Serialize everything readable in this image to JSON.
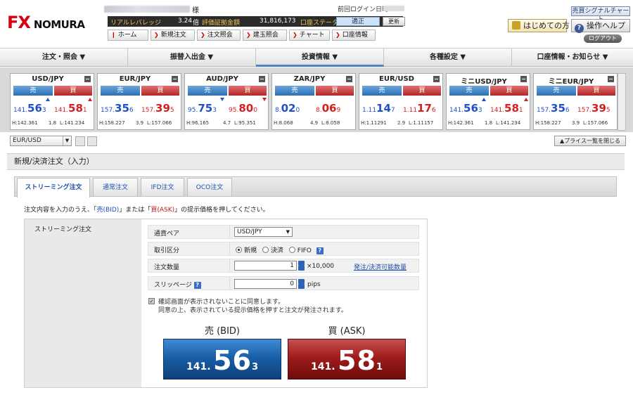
{
  "header": {
    "logo_fx": "FX",
    "logo_nomura": "NOMURA",
    "account_suffix": "様",
    "last_login_label": "前回ログイン日時",
    "leverage_label": "リアルレバレッジ",
    "leverage_value": "3.24",
    "leverage_unit": "倍",
    "valuation_label": "評価証拠金額",
    "valuation_value": "31,816,173",
    "account_status_label": "口座ステータス",
    "account_status_value": "適正",
    "update_label": "更新",
    "nav": [
      "ホーム",
      "新規注文",
      "注文照会",
      "建玉照会",
      "チャート",
      "口座情報"
    ],
    "signal_chart_label": "売買シグナルチャート",
    "getting_started_label": "はじめての方",
    "help_label": "操作ヘルプ",
    "logout_label": "ログアウト"
  },
  "main_menu": [
    "注文・照会 ▼",
    "振替入出金 ▼",
    "投資情報 ▼",
    "各種設定 ▼",
    "口座情報・お知らせ ▼"
  ],
  "rate_panels": [
    {
      "pair": "USD/JPY",
      "sell": "売",
      "buy": "買",
      "bid_small": "141.",
      "bid_large": "56",
      "bid_tail": "3",
      "ask_small": "141.",
      "ask_large": "58",
      "ask_tail": "1",
      "high": "H:142.361",
      "spread": "1.8",
      "low": "L:141.234",
      "bid_arrow": "up",
      "ask_arrow": "up"
    },
    {
      "pair": "EUR/JPY",
      "sell": "売",
      "buy": "買",
      "bid_small": "157.",
      "bid_large": "35",
      "bid_tail": "6",
      "ask_small": "157.",
      "ask_large": "39",
      "ask_tail": "5",
      "high": "H:158.227",
      "spread": "3.9",
      "low": "L:157.066",
      "bid_arrow": "none",
      "ask_arrow": "none"
    },
    {
      "pair": "AUD/JPY",
      "sell": "売",
      "buy": "買",
      "bid_small": "95.",
      "bid_large": "75",
      "bid_tail": "3",
      "ask_small": "95.",
      "ask_large": "80",
      "ask_tail": "0",
      "high": "H:96.165",
      "spread": "4.7",
      "low": "L:95.351",
      "bid_arrow": "down",
      "ask_arrow": "down"
    },
    {
      "pair": "ZAR/JPY",
      "sell": "売",
      "buy": "買",
      "bid_small": "8.",
      "bid_large": "02",
      "bid_tail": "0",
      "ask_small": "8.",
      "ask_large": "06",
      "ask_tail": "9",
      "high": "H:8.068",
      "spread": "4.9",
      "low": "L:8.058",
      "bid_arrow": "none",
      "ask_arrow": "none"
    },
    {
      "pair": "EUR/USD",
      "sell": "売",
      "buy": "買",
      "bid_small": "1.11",
      "bid_large": "14",
      "bid_tail": "7",
      "ask_small": "1.11",
      "ask_large": "17",
      "ask_tail": "6",
      "high": "H:1.11291",
      "spread": "2.9",
      "low": "L:1.11157",
      "bid_arrow": "none",
      "ask_arrow": "none"
    },
    {
      "pair": "ミニUSD/JPY",
      "sell": "売",
      "buy": "買",
      "bid_small": "141.",
      "bid_large": "56",
      "bid_tail": "3",
      "ask_small": "141.",
      "ask_large": "58",
      "ask_tail": "1",
      "high": "H:142.361",
      "spread": "1.8",
      "low": "L:141.234",
      "bid_arrow": "up",
      "ask_arrow": "up"
    },
    {
      "pair": "ミニEUR/JPY",
      "sell": "売",
      "buy": "買",
      "bid_small": "157.",
      "bid_large": "35",
      "bid_tail": "6",
      "ask_small": "157.",
      "ask_large": "39",
      "ask_tail": "5",
      "high": "H:158.227",
      "spread": "3.9",
      "low": "L:157.066",
      "bid_arrow": "none",
      "ask_arrow": "none"
    }
  ],
  "pair_selector": {
    "value": "EUR/USD"
  },
  "close_list_label": "▲プライス一覧を閉じる",
  "order": {
    "title": "新規/決済注文（入力）",
    "tabs": [
      "ストリーミング注文",
      "通常注文",
      "IFD注文",
      "OCO注文"
    ],
    "instruction_pre": "注文内容を入力のうえ、「",
    "instruction_bid": "売(BID)",
    "instruction_mid": "」または「",
    "instruction_ask": "買(ASK)",
    "instruction_post": "」の提示価格を押してください。",
    "side_label": "ストリーミング注文",
    "pair_label": "通貨ペア",
    "pair_value": "USD/JPY",
    "trade_type_label": "取引区分",
    "trade_types": [
      "新規",
      "決済",
      "FIFO"
    ],
    "quantity_label": "注文数量",
    "quantity_value": "1",
    "quantity_unit": "×10,000",
    "available_link": "発注/決済可能数量",
    "slippage_label": "スリッページ",
    "slippage_value": "0",
    "slippage_unit": "pips",
    "confirm_text_1": "確認画面が表示されないことに同意します。",
    "confirm_text_2": "同意の上、表示されている提示価格を押すと注文が発注されます。",
    "bid_label": "売 (BID)",
    "ask_label": "買 (ASK)",
    "bid_price": {
      "small": "141.",
      "large": "56",
      "tail": "3"
    },
    "ask_price": {
      "small": "141.",
      "large": "58",
      "tail": "1"
    }
  }
}
